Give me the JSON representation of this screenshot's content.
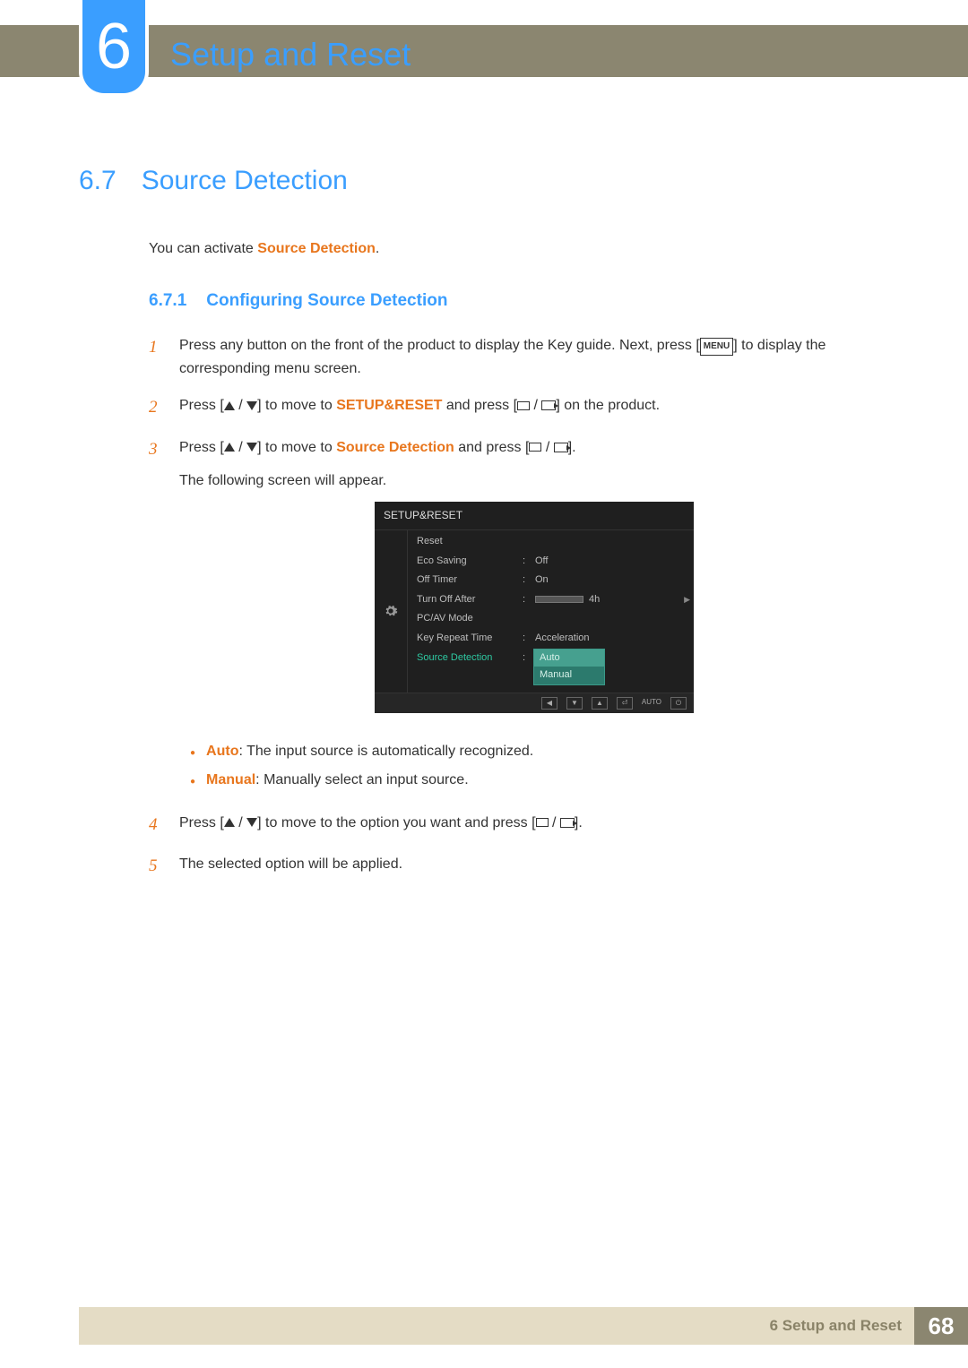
{
  "chapter": {
    "number": "6",
    "title": "Setup and Reset"
  },
  "section": {
    "number": "6.7",
    "title": "Source Detection"
  },
  "intro": {
    "prefix": "You can activate ",
    "highlight": "Source Detection",
    "suffix": "."
  },
  "subsection": {
    "number": "6.7.1",
    "title": "Configuring Source Detection"
  },
  "steps": {
    "s1": {
      "num": "1",
      "a": "Press any button on the front of the product to display the Key guide. Next, press [",
      "b": "] to display the corresponding menu screen."
    },
    "s2": {
      "num": "2",
      "a": "Press [",
      "b": "] to move to ",
      "hl": "SETUP&RESET",
      "c": " and press [",
      "d": "] on the product."
    },
    "s3": {
      "num": "3",
      "a": "Press [",
      "b": "] to move to ",
      "hl": "Source Detection",
      "c": " and press [",
      "d": "].",
      "follow": "The following screen will appear."
    },
    "s4": {
      "num": "4",
      "a": "Press [",
      "b": "] to move to the option you want and press [",
      "c": "]."
    },
    "s5": {
      "num": "5",
      "text": "The selected option will be applied."
    }
  },
  "osd": {
    "title": "SETUP&RESET",
    "items": {
      "reset": "Reset",
      "eco": "Eco Saving",
      "eco_val": "Off",
      "offtimer": "Off Timer",
      "offtimer_val": "On",
      "turnoff": "Turn Off After",
      "turnoff_val": "4h",
      "pcav": "PC/AV Mode",
      "keyrepeat": "Key Repeat Time",
      "keyrepeat_val": "Acceleration",
      "srcdet": "Source Detection"
    },
    "dropdown": {
      "auto": "Auto",
      "manual": "Manual"
    },
    "footer": {
      "auto": "AUTO"
    }
  },
  "bullets": {
    "auto_label": "Auto",
    "auto_text": ": The input source is automatically recognized.",
    "manual_label": "Manual",
    "manual_text": ": Manually select an input source."
  },
  "menu_key": "MENU",
  "footer": {
    "label": "6 Setup and Reset",
    "page": "68"
  }
}
